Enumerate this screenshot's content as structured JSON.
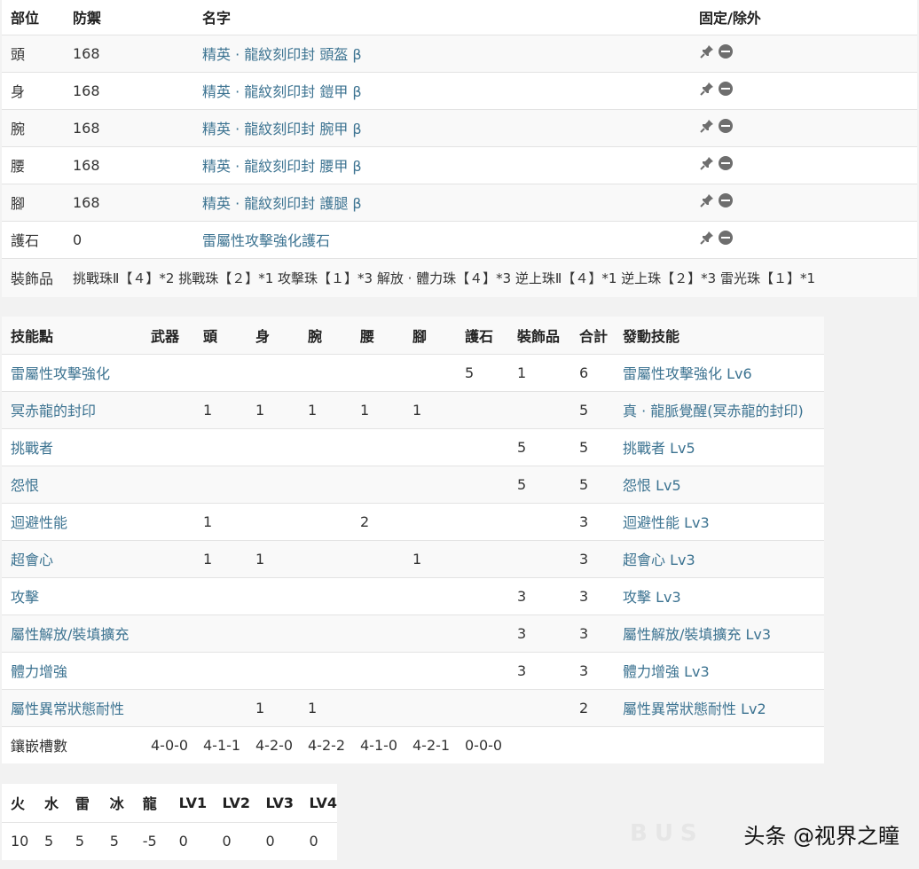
{
  "equipment": {
    "headers": [
      "部位",
      "防禦",
      "名字",
      "固定/除外"
    ],
    "rows": [
      {
        "part": "頭",
        "defense": "168",
        "name": "精英 · 龍紋刻印封 頭盔 β"
      },
      {
        "part": "身",
        "defense": "168",
        "name": "精英 · 龍紋刻印封 鎧甲 β"
      },
      {
        "part": "腕",
        "defense": "168",
        "name": "精英 · 龍紋刻印封 腕甲 β"
      },
      {
        "part": "腰",
        "defense": "168",
        "name": "精英 · 龍紋刻印封 腰甲 β"
      },
      {
        "part": "腳",
        "defense": "168",
        "name": "精英 · 龍紋刻印封 護腿 β"
      },
      {
        "part": "護石",
        "defense": "0",
        "name": "雷屬性攻擊強化護石"
      }
    ],
    "decorations_label": "裝飾品",
    "decorations": "挑戰珠Ⅱ【４】*2 挑戰珠【２】*1 攻擊珠【１】*3 解放 · 體力珠【４】*3 逆上珠Ⅱ【４】*1 逆上珠【２】*3 雷光珠【１】*1",
    "icons": [
      "pin-icon",
      "exclude-icon"
    ]
  },
  "skills": {
    "headers": [
      "技能點",
      "武器",
      "頭",
      "身",
      "腕",
      "腰",
      "腳",
      "護石",
      "裝飾品",
      "合計",
      "發動技能"
    ],
    "rows": [
      {
        "name": "雷屬性攻擊強化",
        "weapon": "",
        "head": "",
        "body": "",
        "arm": "",
        "waist": "",
        "legs": "",
        "charm": "5",
        "deco": "1",
        "total": "6",
        "activated": "雷屬性攻擊強化 Lv6"
      },
      {
        "name": "冥赤龍的封印",
        "weapon": "",
        "head": "1",
        "body": "1",
        "arm": "1",
        "waist": "1",
        "legs": "1",
        "charm": "",
        "deco": "",
        "total": "5",
        "activated": "真 · 龍脈覺醒(冥赤龍的封印)"
      },
      {
        "name": "挑戰者",
        "weapon": "",
        "head": "",
        "body": "",
        "arm": "",
        "waist": "",
        "legs": "",
        "charm": "",
        "deco": "5",
        "total": "5",
        "activated": "挑戰者 Lv5"
      },
      {
        "name": "怨恨",
        "weapon": "",
        "head": "",
        "body": "",
        "arm": "",
        "waist": "",
        "legs": "",
        "charm": "",
        "deco": "5",
        "total": "5",
        "activated": "怨恨 Lv5"
      },
      {
        "name": "迴避性能",
        "weapon": "",
        "head": "1",
        "body": "",
        "arm": "",
        "waist": "2",
        "legs": "",
        "charm": "",
        "deco": "",
        "total": "3",
        "activated": "迴避性能 Lv3"
      },
      {
        "name": "超會心",
        "weapon": "",
        "head": "1",
        "body": "1",
        "arm": "",
        "waist": "",
        "legs": "1",
        "charm": "",
        "deco": "",
        "total": "3",
        "activated": "超會心 Lv3"
      },
      {
        "name": "攻擊",
        "weapon": "",
        "head": "",
        "body": "",
        "arm": "",
        "waist": "",
        "legs": "",
        "charm": "",
        "deco": "3",
        "total": "3",
        "activated": "攻擊 Lv3"
      },
      {
        "name": "屬性解放/裝填擴充",
        "weapon": "",
        "head": "",
        "body": "",
        "arm": "",
        "waist": "",
        "legs": "",
        "charm": "",
        "deco": "3",
        "total": "3",
        "activated": "屬性解放/裝填擴充 Lv3"
      },
      {
        "name": "體力增強",
        "weapon": "",
        "head": "",
        "body": "",
        "arm": "",
        "waist": "",
        "legs": "",
        "charm": "",
        "deco": "3",
        "total": "3",
        "activated": "體力增強 Lv3"
      },
      {
        "name": "屬性異常狀態耐性",
        "weapon": "",
        "head": "",
        "body": "1",
        "arm": "1",
        "waist": "",
        "legs": "",
        "charm": "",
        "deco": "",
        "total": "2",
        "activated": "屬性異常狀態耐性 Lv2"
      }
    ],
    "slots_label": "鑲嵌槽數",
    "slots": [
      "4-0-0",
      "4-1-1",
      "4-2-0",
      "4-2-2",
      "4-1-0",
      "4-2-1",
      "0-0-0"
    ]
  },
  "resistances": {
    "headers": [
      "火",
      "水",
      "雷",
      "冰",
      "龍",
      "LV1",
      "LV2",
      "LV3",
      "LV4"
    ],
    "values": [
      "10",
      "5",
      "5",
      "5",
      "-5",
      "0",
      "0",
      "0",
      "0"
    ]
  },
  "watermark": "头条 @视界之瞳",
  "faint_text": "BUS"
}
